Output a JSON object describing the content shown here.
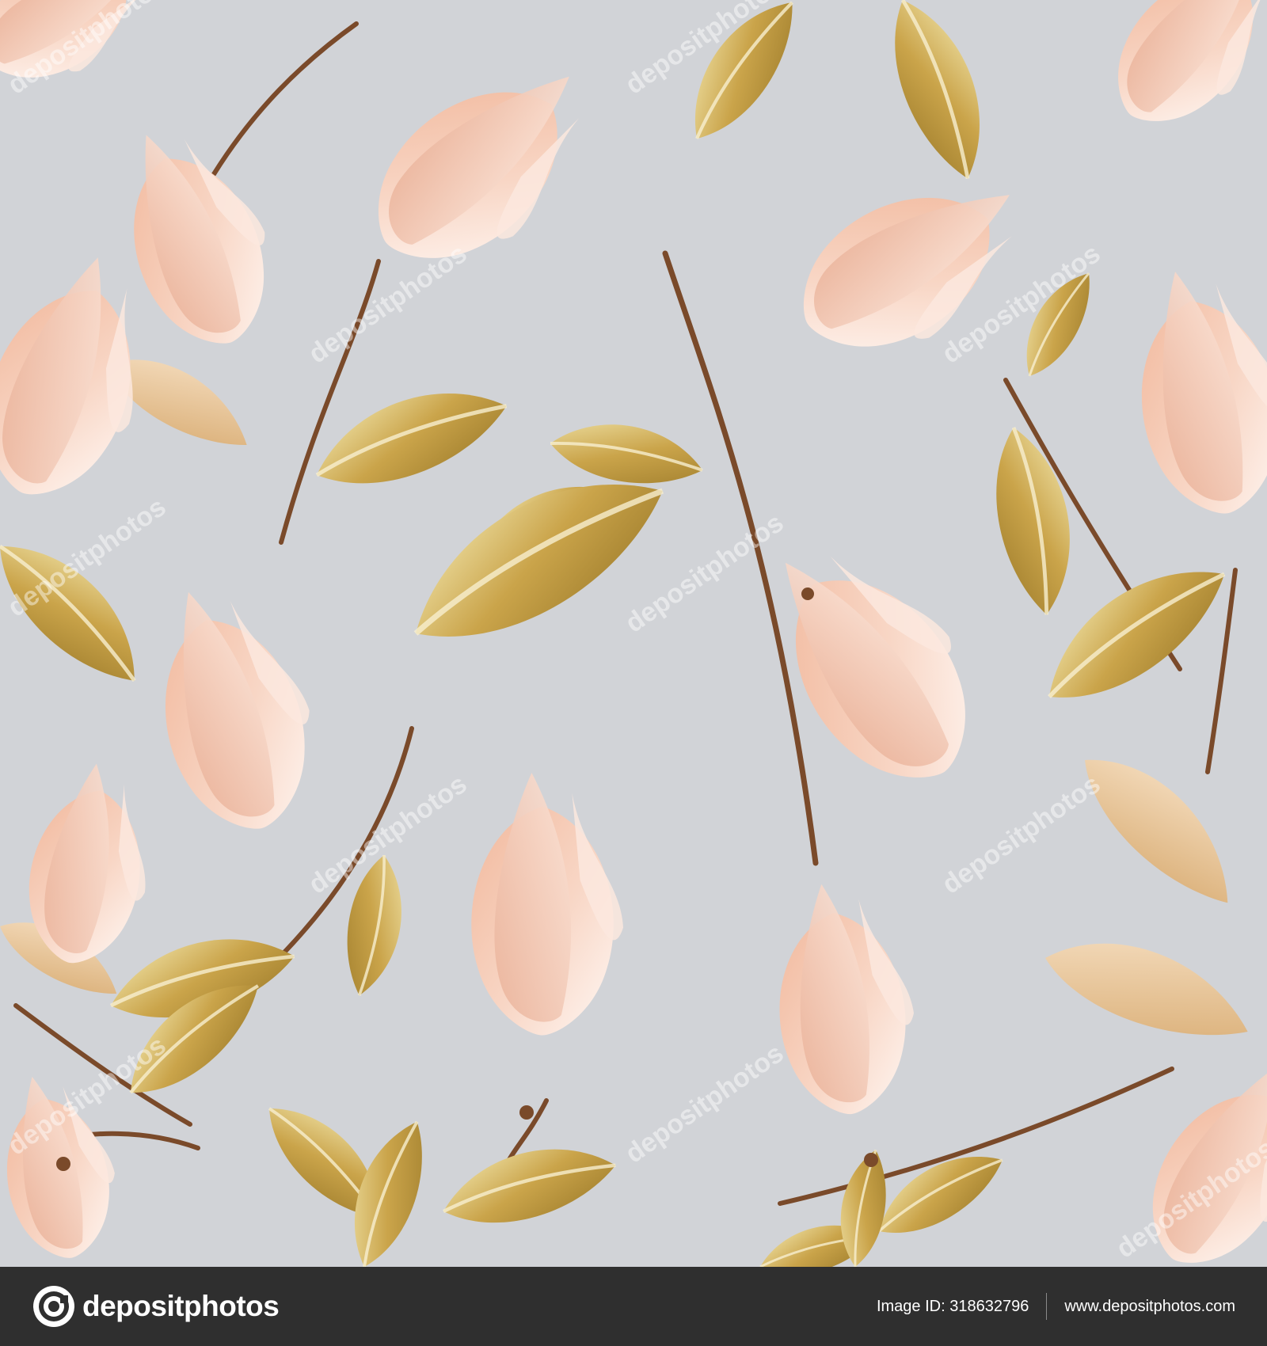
{
  "brand": {
    "name": "depositphotos",
    "logo_icon": "depositphotos-logo-icon",
    "watermark_text": "depositphotos"
  },
  "footer": {
    "image_id_label": "Image ID: 318632796",
    "website": "www.depositphotos.com"
  },
  "colors": {
    "background": "#d1d3d7",
    "footer_bar": "#2f2f2f",
    "petal_pink": "#f5c9b3",
    "petal_light": "#fdf0ea",
    "leaf_gold": "#c9a94e",
    "leaf_gold_light": "#efe2a3",
    "stem_brown": "#7a4a2a"
  }
}
